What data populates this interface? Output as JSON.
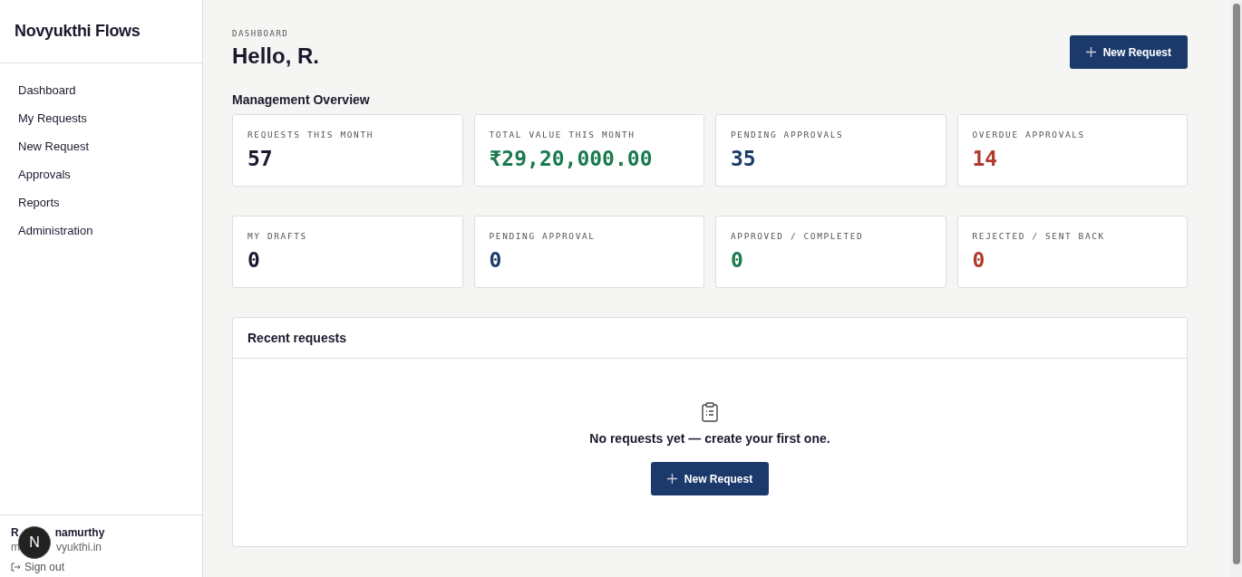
{
  "sidebar": {
    "brand": "Novyukthi Flows",
    "items": [
      {
        "label": "Dashboard"
      },
      {
        "label": "My Requests"
      },
      {
        "label": "New Request"
      },
      {
        "label": "Approvals"
      },
      {
        "label": "Reports"
      },
      {
        "label": "Administration"
      }
    ],
    "user": {
      "name_start": "R",
      "name_end": "namurthy",
      "email_start": "m",
      "email_end": "vyukthi.in",
      "badge": "N",
      "sign_out": "Sign out"
    }
  },
  "header": {
    "eyebrow": "DASHBOARD",
    "title": "Hello, R.",
    "button": "New Request"
  },
  "section_title": "Management Overview",
  "stat_rows": [
    [
      {
        "label": "REQUESTS THIS MONTH",
        "value": "57",
        "color": "#1a1a2e"
      },
      {
        "label": "TOTAL VALUE THIS MONTH",
        "value": "₹29,20,000.00",
        "color": "#1a7a4f"
      },
      {
        "label": "PENDING APPROVALS",
        "value": "35",
        "color": "#1b3a6b"
      },
      {
        "label": "OVERDUE APPROVALS",
        "value": "14",
        "color": "#b03a2e"
      }
    ],
    [
      {
        "label": "MY DRAFTS",
        "value": "0",
        "color": "#1a1a2e"
      },
      {
        "label": "PENDING APPROVAL",
        "value": "0",
        "color": "#1b3a6b"
      },
      {
        "label": "APPROVED / COMPLETED",
        "value": "0",
        "color": "#1a7a4f"
      },
      {
        "label": "REJECTED / SENT BACK",
        "value": "0",
        "color": "#b03a2e"
      }
    ]
  ],
  "recent": {
    "title": "Recent requests",
    "empty_message": "No requests yet — create your first one.",
    "button": "New Request"
  }
}
